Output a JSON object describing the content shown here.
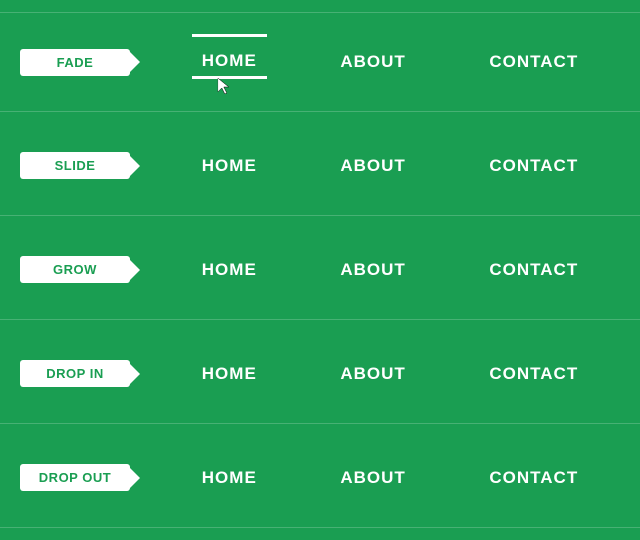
{
  "rows": [
    {
      "label": "FADE",
      "items": [
        "HOME",
        "ABOUT",
        "CONTACT"
      ],
      "activeIndex": 0,
      "showCursor": true
    },
    {
      "label": "SLIDE",
      "items": [
        "HOME",
        "ABOUT",
        "CONTACT"
      ],
      "activeIndex": -1,
      "showCursor": false
    },
    {
      "label": "GROW",
      "items": [
        "HOME",
        "ABOUT",
        "CONTACT"
      ],
      "activeIndex": -1,
      "showCursor": false
    },
    {
      "label": "DROP IN",
      "items": [
        "HOME",
        "ABOUT",
        "CONTACT"
      ],
      "activeIndex": -1,
      "showCursor": false
    },
    {
      "label": "DROP OUT",
      "items": [
        "HOME",
        "ABOUT",
        "CONTACT"
      ],
      "activeIndex": -1,
      "showCursor": false
    }
  ]
}
